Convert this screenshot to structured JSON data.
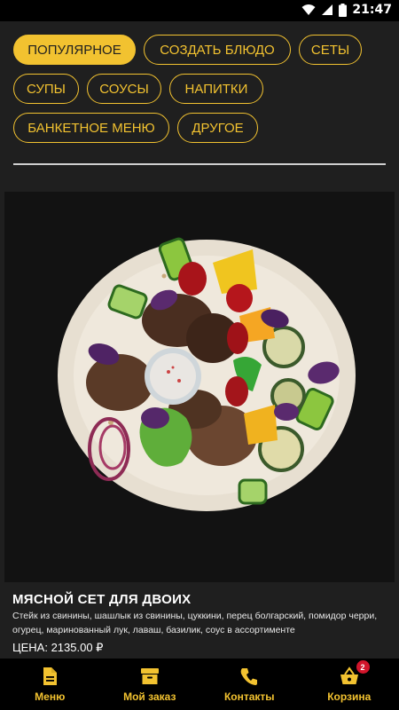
{
  "status_bar": {
    "time": "21:47"
  },
  "categories": {
    "rows": [
      [
        {
          "label": "ПОПУЛЯРНОЕ",
          "active": true
        },
        {
          "label": "СОЗДАТЬ БЛЮДО"
        },
        {
          "label": "СЕТЫ"
        }
      ],
      [
        {
          "label": "СУПЫ"
        },
        {
          "label": "СОУСЫ"
        },
        {
          "label": "НАПИТКИ"
        }
      ],
      [
        {
          "label": "БАНКЕТНОЕ МЕНЮ"
        },
        {
          "label": "ДРУГОЕ"
        }
      ]
    ]
  },
  "product": {
    "title": "МЯСНОЙ СЕТ ДЛЯ ДВОИХ",
    "description": "Стейк из свинины, шашлык из свинины, цуккини, перец болгарский, помидор черри, огурец, маринованный лук, лаваш, базилик, соус в ассортименте",
    "price": "ЦЕНА: 2135.00 ₽"
  },
  "bottom_nav": {
    "items": [
      {
        "label": "Меню",
        "icon": "document-icon"
      },
      {
        "label": "Мой заказ",
        "icon": "archive-box-icon"
      },
      {
        "label": "Контакты",
        "icon": "phone-icon"
      },
      {
        "label": "Корзина",
        "icon": "basket-icon",
        "badge": "2"
      }
    ]
  },
  "colors": {
    "accent": "#f2c230",
    "background": "#1f1f1f",
    "badge": "#d2152b"
  }
}
